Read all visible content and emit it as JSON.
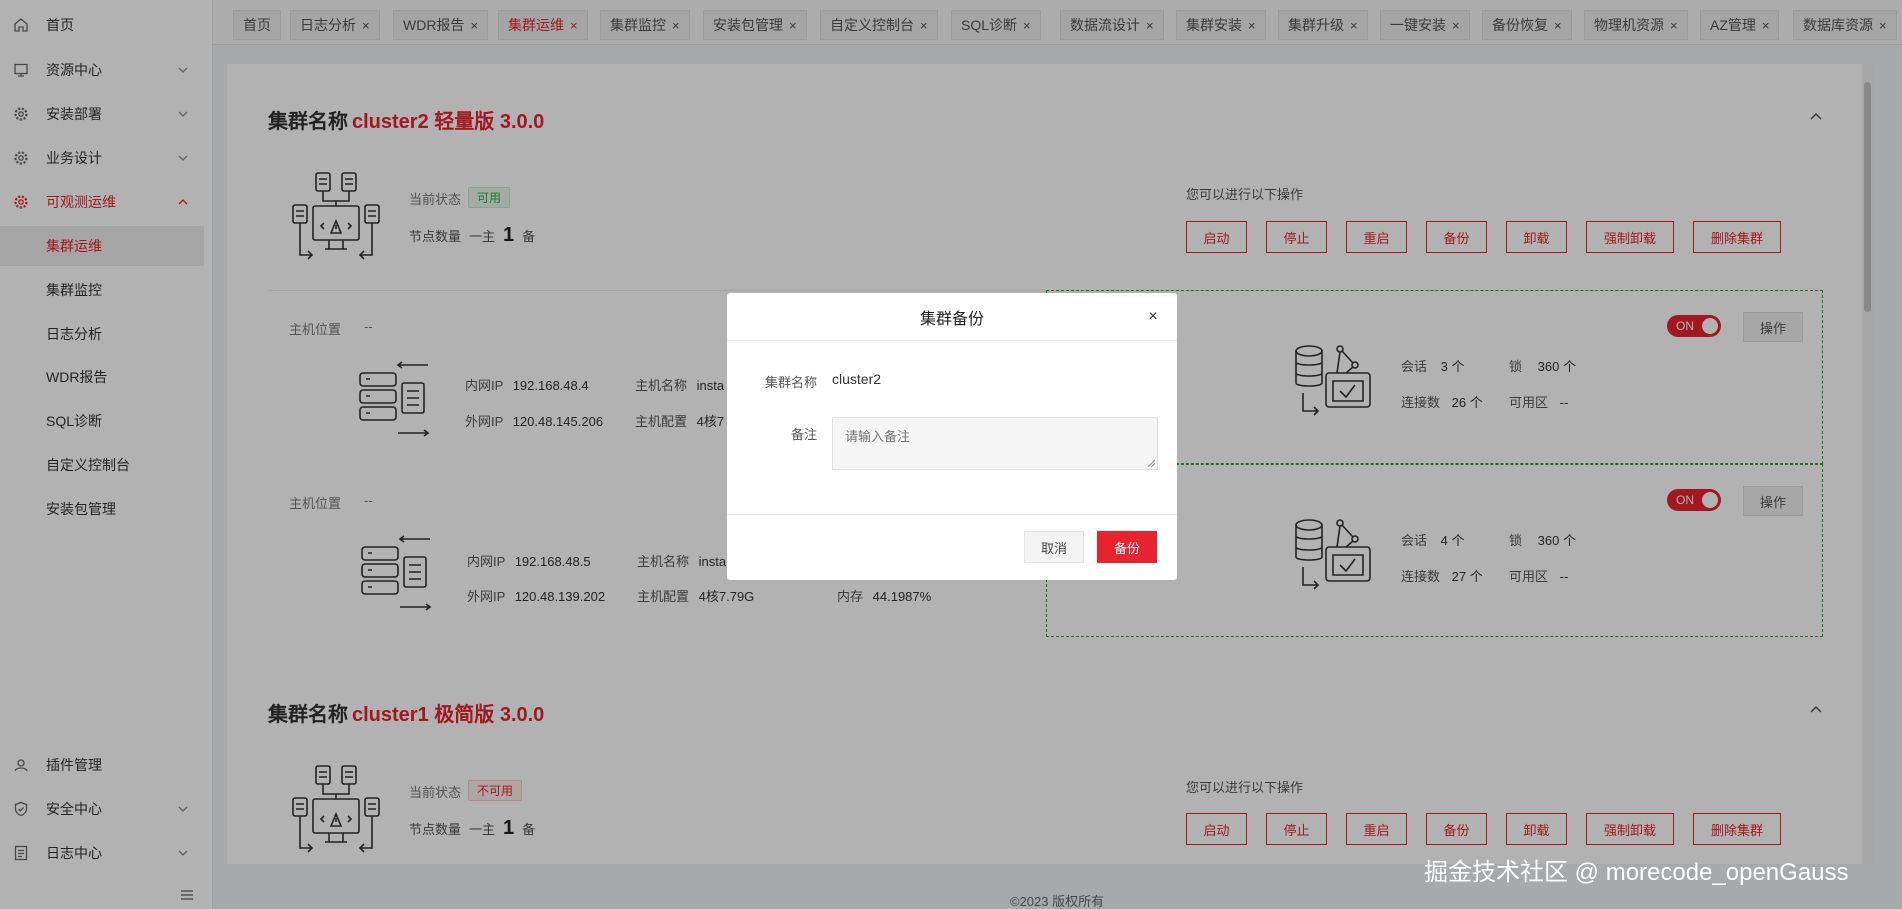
{
  "sidebar": {
    "items": [
      {
        "label": "首页",
        "icon": "home-icon"
      },
      {
        "label": "资源中心",
        "icon": "monitor-icon"
      },
      {
        "label": "安装部署",
        "icon": "gear-icon"
      },
      {
        "label": "业务设计",
        "icon": "gear-icon"
      },
      {
        "label": "可观测运维",
        "icon": "gear-icon"
      }
    ],
    "sub_items": [
      "集群运维",
      "集群监控",
      "日志分析",
      "WDR报告",
      "SQL诊断",
      "自定义控制台",
      "安装包管理"
    ],
    "bottom_items": [
      {
        "label": "插件管理",
        "icon": "plugin-icon"
      },
      {
        "label": "安全中心",
        "icon": "shield-icon"
      },
      {
        "label": "日志中心",
        "icon": "log-icon"
      }
    ]
  },
  "tabs": [
    {
      "label": "首页"
    },
    {
      "label": "日志分析"
    },
    {
      "label": "WDR报告"
    },
    {
      "label": "集群运维"
    },
    {
      "label": "集群监控"
    },
    {
      "label": "安装包管理"
    },
    {
      "label": "自定义控制台"
    },
    {
      "label": "SQL诊断"
    },
    {
      "label": "数据流设计"
    },
    {
      "label": "集群安装"
    },
    {
      "label": "集群升级"
    },
    {
      "label": "一键安装"
    },
    {
      "label": "备份恢复"
    },
    {
      "label": "物理机资源"
    },
    {
      "label": "AZ管理"
    },
    {
      "label": "数据库资源"
    }
  ],
  "cluster2": {
    "title_prefix": "集群名称",
    "title_name": "cluster2 轻量版 3.0.0",
    "status_label": "当前状态",
    "status": "可用",
    "nodes_label": "节点数量",
    "nodes_primary": "一主",
    "nodes_count": "1",
    "nodes_standby": "备",
    "ops_hint": "您可以进行以下操作",
    "ops": [
      "启动",
      "停止",
      "重启",
      "备份",
      "卸载",
      "强制卸载",
      "删除集群"
    ],
    "hosts": [
      {
        "location_label": "主机位置",
        "location": "--",
        "inner_ip_label": "内网IP",
        "inner_ip": "192.168.48.4",
        "outer_ip_label": "外网IP",
        "outer_ip": "120.48.145.206",
        "host_name_label": "主机名称",
        "host_name": "insta",
        "host_config_label": "主机配置",
        "host_config": "4核7",
        "session_label": "会话",
        "session": "3 个",
        "lock_label": "锁",
        "lock": "360 个",
        "conn_label": "连接数",
        "conn": "26 个",
        "zone_label": "可用区",
        "zone": "--",
        "toggle": "ON",
        "action": "操作"
      },
      {
        "location_label": "主机位置",
        "location": "--",
        "inner_ip_label": "内网IP",
        "inner_ip": "192.168.48.5",
        "outer_ip_label": "外网IP",
        "outer_ip": "120.48.139.202",
        "host_name_label": "主机名称",
        "host_name": "insta",
        "host_config_label": "主机配置",
        "host_config": "4核7.79G",
        "mem_label": "内存",
        "mem": "44.1987%",
        "session_label": "会话",
        "session": "4 个",
        "lock_label": "锁",
        "lock": "360 个",
        "conn_label": "连接数",
        "conn": "27 个",
        "zone_label": "可用区",
        "zone": "--",
        "toggle": "ON",
        "action": "操作"
      }
    ]
  },
  "cluster1": {
    "title_prefix": "集群名称",
    "title_name": "cluster1 极简版 3.0.0",
    "status_label": "当前状态",
    "status": "不可用",
    "nodes_label": "节点数量",
    "nodes_primary": "一主",
    "nodes_count": "1",
    "nodes_standby": "备",
    "ops_hint": "您可以进行以下操作",
    "ops": [
      "启动",
      "停止",
      "重启",
      "备份",
      "卸载",
      "强制卸载",
      "删除集群"
    ]
  },
  "modal": {
    "title": "集群备份",
    "cluster_label": "集群名称",
    "cluster_value": "cluster2",
    "remark_label": "备注",
    "remark_placeholder": "请输入备注",
    "cancel": "取消",
    "confirm": "备份"
  },
  "footer": {
    "copyright": "©2023 版权所有"
  },
  "watermark": "掘金技术社区 @ morecode_openGauss",
  "colors": {
    "accent": "#e8232f",
    "ok": "#2ea64a",
    "dashed_border": "#3a9a3a"
  }
}
